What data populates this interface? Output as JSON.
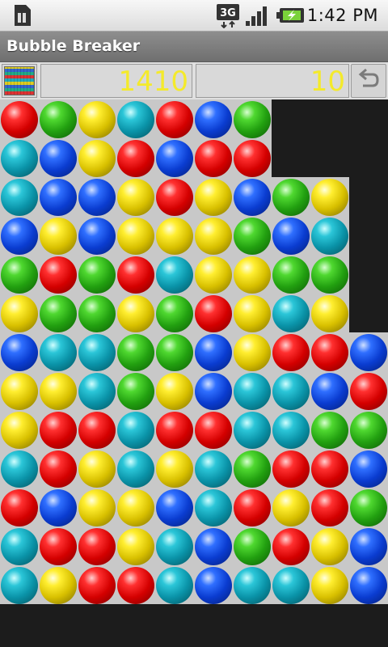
{
  "status_bar": {
    "time": "1:42 PM",
    "network": "3G",
    "icons": [
      "sim-card-icon",
      "3g-signal-icon",
      "signal-strength-icon",
      "battery-icon"
    ]
  },
  "app": {
    "title": "Bubble Breaker"
  },
  "toolbar": {
    "score": "1410",
    "selection_value": "10",
    "undo_icon": "undo-arrow-icon"
  },
  "colors": {
    "score_text": "#f4ea2a",
    "board_bg": "#c8c8c8",
    "empty_bg": "#1c1c1c"
  },
  "board": {
    "columns": 10,
    "rows": 13,
    "grid": [
      [
        "red",
        "green",
        "yellow",
        "cyan",
        "red",
        "blue",
        "green",
        null,
        null,
        null
      ],
      [
        "cyan",
        "blue",
        "yellow",
        "red",
        "blue",
        "red",
        "red",
        null,
        null,
        null
      ],
      [
        "cyan",
        "blue",
        "blue",
        "yellow",
        "red",
        "yellow",
        "blue",
        "green",
        "yellow",
        null
      ],
      [
        "blue",
        "yellow",
        "blue",
        "yellow",
        "yellow",
        "yellow",
        "green",
        "blue",
        "cyan",
        null
      ],
      [
        "green",
        "red",
        "green",
        "red",
        "cyan",
        "yellow",
        "yellow",
        "green",
        "green",
        null
      ],
      [
        "yellow",
        "green",
        "green",
        "yellow",
        "green",
        "red",
        "yellow",
        "cyan",
        "yellow",
        null
      ],
      [
        "blue",
        "cyan",
        "cyan",
        "green",
        "green",
        "blue",
        "yellow",
        "red",
        "red",
        "blue"
      ],
      [
        "yellow",
        "yellow",
        "cyan",
        "green",
        "yellow",
        "blue",
        "cyan",
        "cyan",
        "blue",
        "red"
      ],
      [
        "yellow",
        "red",
        "red",
        "cyan",
        "red",
        "red",
        "cyan",
        "cyan",
        "green",
        "green"
      ],
      [
        "cyan",
        "red",
        "yellow",
        "cyan",
        "yellow",
        "cyan",
        "green",
        "red",
        "red",
        "blue"
      ],
      [
        "red",
        "blue",
        "yellow",
        "yellow",
        "blue",
        "cyan",
        "red",
        "yellow",
        "red",
        "green"
      ],
      [
        "cyan",
        "red",
        "red",
        "yellow",
        "cyan",
        "blue",
        "green",
        "red",
        "yellow",
        "blue"
      ],
      [
        "cyan",
        "yellow",
        "red",
        "red",
        "cyan",
        "blue",
        "cyan",
        "cyan",
        "yellow",
        "blue"
      ]
    ]
  }
}
